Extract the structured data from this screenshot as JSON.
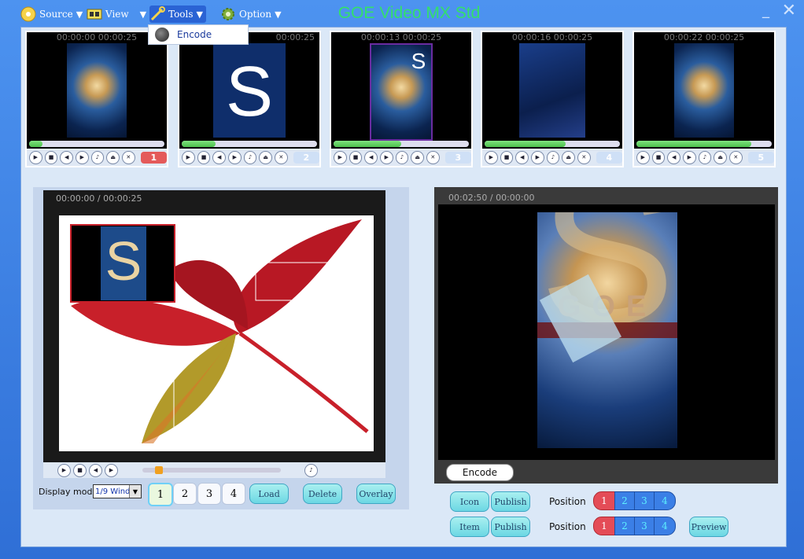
{
  "app": {
    "title": "GOE Video MX Std"
  },
  "menu": [
    {
      "label": "Source",
      "icon": "disc-icon"
    },
    {
      "label": "View",
      "icon": "film-icon"
    },
    {
      "label": "Tools",
      "icon": "wrench-icon"
    },
    {
      "label": "Option",
      "icon": "gear-icon"
    }
  ],
  "tools_menu": {
    "items": [
      {
        "label": "Encode"
      }
    ]
  },
  "thumbs": [
    {
      "time": "00:00:00  00:00:25",
      "number": "1",
      "progress": 0.1
    },
    {
      "time": "00:00:25",
      "number": "2",
      "progress": 0.25
    },
    {
      "time": "00:00:13  00:00:25",
      "number": "3",
      "progress": 0.5
    },
    {
      "time": "00:00:16  00:00:25",
      "number": "4",
      "progress": 0.6
    },
    {
      "time": "00:00:22  00:00:25",
      "number": "5",
      "progress": 0.85
    }
  ],
  "preview_left": {
    "time": "00:00:00 / 00:00:25"
  },
  "display_mode": {
    "label": "Display mode",
    "value": "1/9 Wind"
  },
  "num_buttons": [
    "1",
    "2",
    "3",
    "4"
  ],
  "left_actions": {
    "load": "Load",
    "delete": "Delete",
    "overlay": "Overlay"
  },
  "preview_right": {
    "time": "00:02:50 / 00:00:00",
    "encode": "Encode",
    "overlay_text": "GOE"
  },
  "bottom": {
    "icon_label": "Icon",
    "item_label": "Item",
    "publish_label": "Publish",
    "position_label": "Position",
    "preview_label": "Preview",
    "positions": [
      "1",
      "2",
      "3",
      "4"
    ]
  },
  "colors": {
    "accent": "#3b7fd8",
    "title_green": "#33e06a",
    "active_red": "#e45a5a"
  }
}
